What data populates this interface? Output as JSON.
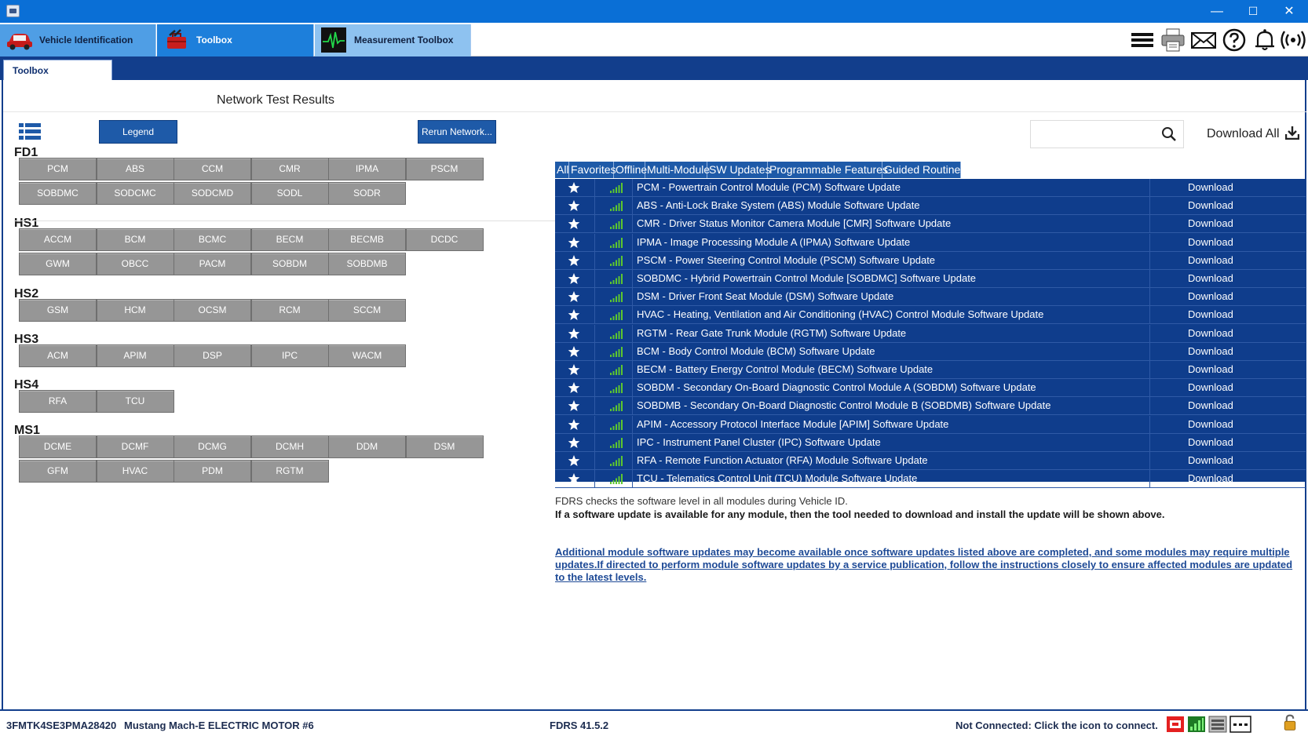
{
  "window": {
    "minimize": "—",
    "maximize": "☐",
    "close": "✕"
  },
  "app_tabs": [
    {
      "label": "Vehicle Identification",
      "icon": "car-icon"
    },
    {
      "label": "Toolbox",
      "icon": "toolbox-icon"
    },
    {
      "label": "Measurement Toolbox",
      "icon": "oscilloscope-icon"
    }
  ],
  "toolbar_icons": [
    "menu-icon",
    "printer-icon",
    "mail-icon",
    "help-icon",
    "bell-icon",
    "wireless-icon"
  ],
  "sub_tab": "Toolbox",
  "page": {
    "title": "Network Test Results",
    "legend_button": "Legend",
    "rerun_button": "Rerun Network...",
    "download_all": "Download All",
    "search_placeholder": ""
  },
  "groups": [
    {
      "name": "FD1",
      "modules": [
        "PCM",
        "ABS",
        "CCM",
        "CMR",
        "IPMA",
        "PSCM",
        "SOBDMC",
        "SODCMC",
        "SODCMD",
        "SODL",
        "SODR"
      ]
    },
    {
      "name": "HS1",
      "modules": [
        "ACCM",
        "BCM",
        "BCMC",
        "BECM",
        "BECMB",
        "DCDC",
        "GWM",
        "OBCC",
        "PACM",
        "SOBDM",
        "SOBDMB"
      ]
    },
    {
      "name": "HS2",
      "modules": [
        "GSM",
        "HCM",
        "OCSM",
        "RCM",
        "SCCM"
      ]
    },
    {
      "name": "HS3",
      "modules": [
        "ACM",
        "APIM",
        "DSP",
        "IPC",
        "WACM"
      ]
    },
    {
      "name": "HS4",
      "modules": [
        "RFA",
        "TCU"
      ]
    },
    {
      "name": "MS1",
      "modules": [
        "DCME",
        "DCMF",
        "DCMG",
        "DCMH",
        "DDM",
        "DSM",
        "GFM",
        "HVAC",
        "PDM",
        "RGTM"
      ]
    }
  ],
  "filters": [
    "All",
    "Favorites",
    "Offline",
    "Multi-Module",
    "SW Updates",
    "Programmable Features",
    "Guided Routines"
  ],
  "updates": [
    {
      "desc": "PCM - Powertrain Control Module (PCM) Software Update",
      "action": "Download"
    },
    {
      "desc": "ABS - Anti-Lock Brake System (ABS) Module Software Update",
      "action": "Download"
    },
    {
      "desc": "CMR - Driver Status Monitor Camera Module [CMR] Software Update",
      "action": "Download"
    },
    {
      "desc": "IPMA - Image Processing Module A (IPMA) Software Update",
      "action": "Download"
    },
    {
      "desc": "PSCM - Power Steering Control Module (PSCM) Software Update",
      "action": "Download"
    },
    {
      "desc": "SOBDMC - Hybrid Powertrain Control Module [SOBDMC] Software Update",
      "action": "Download"
    },
    {
      "desc": "DSM - Driver Front Seat Module (DSM) Software Update",
      "action": "Download"
    },
    {
      "desc": "HVAC - Heating, Ventilation and Air Conditioning (HVAC) Control Module Software Update",
      "action": "Download"
    },
    {
      "desc": "RGTM - Rear Gate Trunk Module (RGTM) Software Update",
      "action": "Download"
    },
    {
      "desc": "BCM - Body Control Module (BCM) Software Update",
      "action": "Download"
    },
    {
      "desc": "BECM - Battery Energy Control Module (BECM) Software Update",
      "action": "Download"
    },
    {
      "desc": "SOBDM - Secondary On-Board Diagnostic Control Module A (SOBDM) Software Update",
      "action": "Download"
    },
    {
      "desc": "SOBDMB - Secondary On-Board Diagnostic Control Module B (SOBDMB) Software Update",
      "action": "Download"
    },
    {
      "desc": "APIM - Accessory Protocol Interface Module [APIM] Software Update",
      "action": "Download"
    },
    {
      "desc": "IPC - Instrument Panel Cluster (IPC) Software Update",
      "action": "Download"
    },
    {
      "desc": "RFA - Remote Function Actuator (RFA) Module Software Update",
      "action": "Download"
    },
    {
      "desc": "TCU - Telematics Control Unit (TCU) Module Software Update",
      "action": "Download"
    }
  ],
  "notes": {
    "line1": "FDRS checks the software level in all modules during Vehicle ID.",
    "line2": "If a software update is available for any module, then the tool needed to download and install the update will be shown above.",
    "line3": "Additional module software updates may become available once software updates listed above are completed, and some modules may require multiple updates.If directed to perform module software updates by a service publication, follow the instructions closely to ensure affected modules are updated to the latest levels."
  },
  "status": {
    "vin": "3FMTK4SE3PMA28420",
    "vehicle": "Mustang Mach-E ELECTRIC MOTOR #6",
    "version": "FDRS 41.5.2",
    "connection": "Not Connected: Click the icon to connect.",
    "icons": [
      "vci-icon",
      "signal-icon",
      "network-icon",
      "dots-icon",
      "lock-icon"
    ]
  },
  "colors": {
    "titlebar": "#0a6fd6",
    "navy": "#0f3d8c",
    "module_button": "#969696",
    "signal_green": "#5cc72e"
  }
}
